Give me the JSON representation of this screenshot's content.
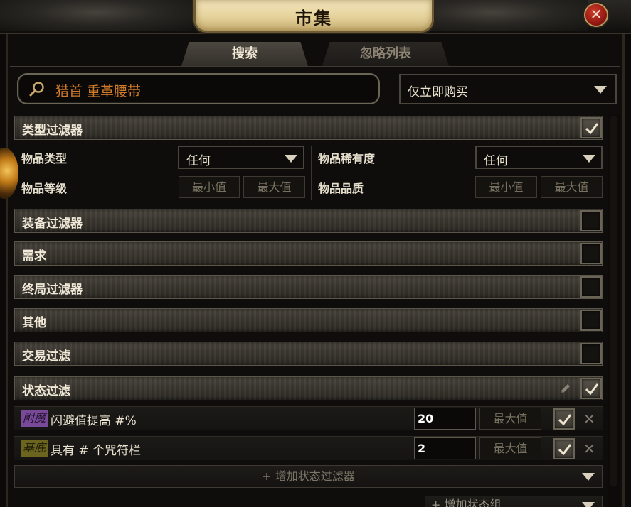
{
  "window": {
    "title": "市集",
    "close_symbol": "✕"
  },
  "tabs": [
    {
      "label": "搜索",
      "active": true
    },
    {
      "label": "忽略列表",
      "active": false
    }
  ],
  "search": {
    "value": "猎首 重革腰带",
    "icon": "magnifier-icon"
  },
  "buy_mode": {
    "selected": "仅立即购买"
  },
  "type_filters": {
    "label": "类型过滤器",
    "checked": true,
    "item_type_label": "物品类型",
    "item_type_value": "任何",
    "rarity_label": "物品稀有度",
    "rarity_value": "任何",
    "item_level_label": "物品等级",
    "quality_label": "物品品质",
    "min_placeholder": "最小值",
    "max_placeholder": "最大值"
  },
  "collapsed_filters": [
    {
      "label": "装备过滤器",
      "checked": false
    },
    {
      "label": "需求",
      "checked": false
    },
    {
      "label": "终局过滤器",
      "checked": false
    },
    {
      "label": "其他",
      "checked": false
    },
    {
      "label": "交易过滤",
      "checked": false
    }
  ],
  "stat_filters": {
    "label": "状态过滤",
    "checked": true,
    "rows": [
      {
        "tag": "附魔",
        "tag_color": "#7a4a9a",
        "text": "闪避值提高 #%",
        "min": "20",
        "max_placeholder": "最大值",
        "checked": true
      },
      {
        "tag": "基底",
        "tag_color": "#6b6520",
        "text": "具有 # 个咒符栏",
        "min": "2",
        "max_placeholder": "最大值",
        "checked": true
      }
    ],
    "add_label": "+ 增加状态过滤器",
    "add_group_label": "+ 增加状态组"
  },
  "colors": {
    "accent_orange": "#d07a2a",
    "text_light": "#e8e0cc",
    "muted": "#77705f"
  }
}
